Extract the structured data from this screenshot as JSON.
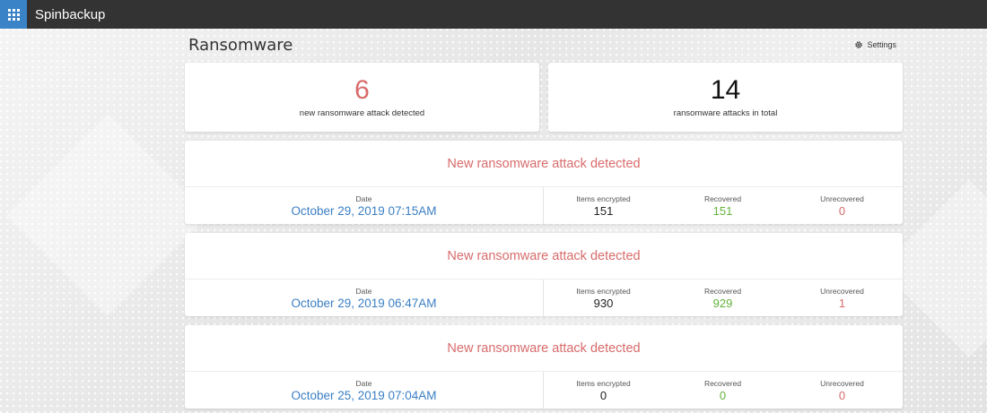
{
  "app": {
    "name": "Spinbackup"
  },
  "page": {
    "title": "Ransomware",
    "settings_label": "Settings"
  },
  "summary": [
    {
      "value": "6",
      "label": "new ransomware attack detected",
      "color": "#d86b6b"
    },
    {
      "value": "14",
      "label": "ransomware attacks in total",
      "color": "#111111"
    }
  ],
  "stat_labels": {
    "date": "Date",
    "encrypted": "Items encrypted",
    "recovered": "Recovered",
    "unrecovered": "Unrecovered"
  },
  "attacks": [
    {
      "title": "New ransomware attack detected",
      "date": "October 29, 2019 07:15AM",
      "encrypted": "151",
      "recovered": "151",
      "unrecovered": "0"
    },
    {
      "title": "New ransomware attack detected",
      "date": "October 29, 2019 06:47AM",
      "encrypted": "930",
      "recovered": "929",
      "unrecovered": "1"
    },
    {
      "title": "New ransomware attack detected",
      "date": "October 25, 2019 07:04AM",
      "encrypted": "0",
      "recovered": "0",
      "unrecovered": "0"
    }
  ],
  "colors": {
    "topbar": "#333333",
    "launcher": "#3b83c7",
    "alert_red": "#d86b6b",
    "recovered_green": "#62b33a",
    "date_blue": "#3b7fc4"
  },
  "icons": {
    "launcher": "app-grid-icon",
    "settings": "gear-icon"
  }
}
